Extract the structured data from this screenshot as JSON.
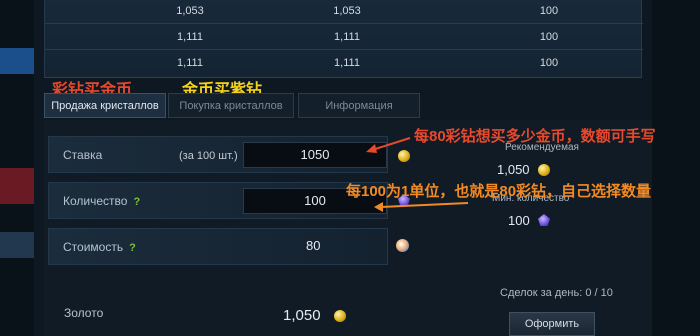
{
  "table": {
    "rows": [
      [
        "1,053",
        "1,053",
        "100"
      ],
      [
        "1,111",
        "1,111",
        "100"
      ],
      [
        "1,111",
        "1,111",
        "100"
      ]
    ]
  },
  "annotations": {
    "sell_label": "彩钻买金币",
    "buy_label": "金币买紫钻",
    "price_note": "每80彩钻想买多少金币，数额可手写",
    "quantity_note": "每100为1单位，也就是80彩钻，自己选择数量"
  },
  "tabs": [
    {
      "label": "Продажа кристаллов"
    },
    {
      "label": "Покупка кристаллов"
    },
    {
      "label": "Информация"
    }
  ],
  "form": {
    "rate_label": "Ставка",
    "rate_unit": "(за 100 шт.)",
    "rate_value": "1050",
    "quantity_label": "Количество",
    "quantity_value": "100",
    "cost_label": "Стоимость",
    "cost_value": "80",
    "gold_label": "Золото",
    "gold_value": "1,050",
    "help_mark": "?"
  },
  "side": {
    "recommended_label": "Рекомендуемая",
    "recommended_value": "1,050",
    "min_qty_label": "Мин. количество",
    "min_qty_value": "100",
    "deals_label": "Сделок за день: 0 / 10",
    "submit_label": "Оформить"
  },
  "icons": {
    "coin": "gold-coin-icon",
    "gem": "purple-gem-icon",
    "orb": "crystal-orb-icon"
  }
}
